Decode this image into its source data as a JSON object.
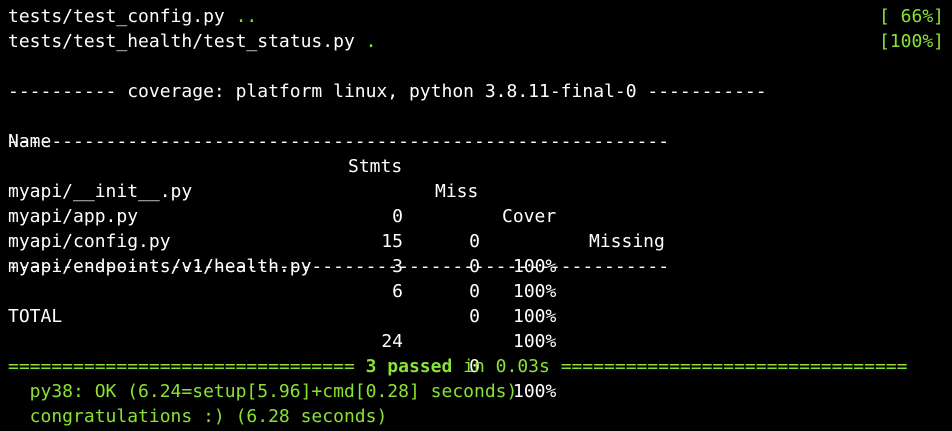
{
  "colors": {
    "background": "#000000",
    "text": "#ffffff",
    "accent_green": "#8ae234"
  },
  "tests": [
    {
      "file": "tests/test_config.py",
      "dots": "..",
      "progress": "[ 66%]"
    },
    {
      "file": "tests/test_health/test_status.py",
      "dots": ".",
      "progress": "[100%]"
    }
  ],
  "coverage": {
    "header": "---------- coverage: platform linux, python 3.8.11-final-0 -----------",
    "columns": {
      "name": "Name",
      "stmts": "Stmts",
      "miss": "Miss",
      "cover": "Cover",
      "missing": "Missing"
    },
    "divider": "-------------------------------------------------------------",
    "rows": [
      {
        "name": "myapi/__init__.py",
        "stmts": "0",
        "miss": "0",
        "cover": "100%"
      },
      {
        "name": "myapi/app.py",
        "stmts": "15",
        "miss": "0",
        "cover": "100%"
      },
      {
        "name": "myapi/config.py",
        "stmts": "3",
        "miss": "0",
        "cover": "100%"
      },
      {
        "name": "myapi/endpoints/v1/health.py",
        "stmts": "6",
        "miss": "0",
        "cover": "100%"
      }
    ],
    "total": {
      "name": "TOTAL",
      "stmts": "24",
      "miss": "0",
      "cover": "100%"
    }
  },
  "summary": {
    "left_rule": "================================",
    "passed": "3 passed",
    "duration": " in 0.03s ",
    "right_rule": "================================"
  },
  "tox": {
    "py38": "  py38: OK (6.24=setup[5.96]+cmd[0.28] seconds)",
    "congrats": "  congratulations :) (6.28 seconds)"
  }
}
